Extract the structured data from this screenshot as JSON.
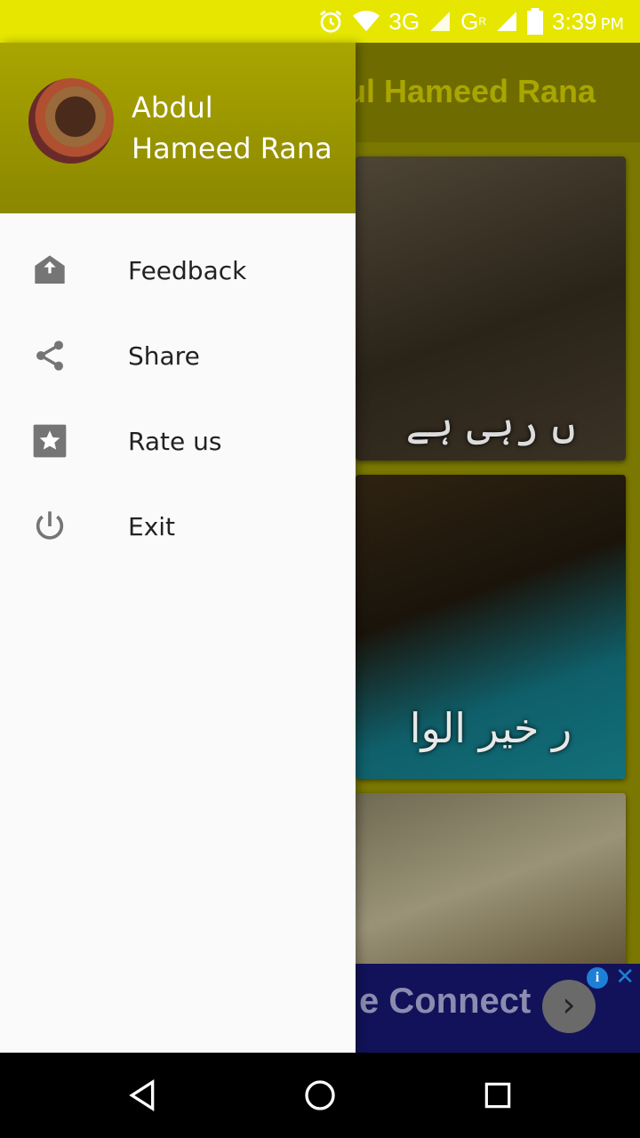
{
  "status_bar": {
    "network": "3G",
    "network2": "G",
    "roaming": "R",
    "time": "3:39",
    "ampm": "PM"
  },
  "toolbar": {
    "title": "Abdul Hameed Rana"
  },
  "cards": [
    {
      "caption": "ں رہی ہے"
    },
    {
      "caption": "ر خیر الوا"
    },
    {
      "caption": ""
    }
  ],
  "ad": {
    "text": "e Connect"
  },
  "drawer": {
    "header_name": "Abdul Hameed Rana",
    "items": [
      {
        "label": "Feedback",
        "icon": "feedback-icon"
      },
      {
        "label": "Share",
        "icon": "share-icon"
      },
      {
        "label": "Rate us",
        "icon": "star-icon"
      },
      {
        "label": "Exit",
        "icon": "power-icon"
      }
    ]
  },
  "colors": {
    "status_bar": "#e6e600",
    "header": "#a9a500",
    "drawer_bg": "#fafafa",
    "icon": "#757575"
  }
}
